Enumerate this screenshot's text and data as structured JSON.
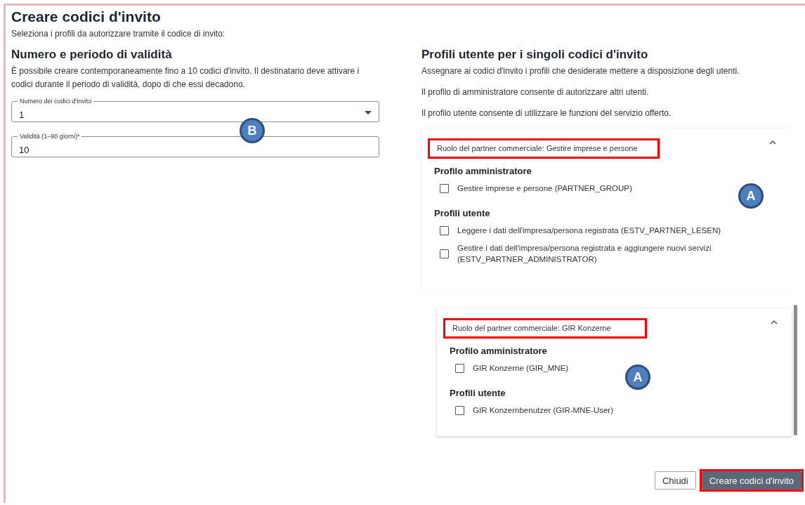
{
  "title": "Creare codici d'invito",
  "subtitle": "Seleziona i profili da autorizzare tramite il codice di invito:",
  "validity": {
    "heading": "Numero e periodo di validità",
    "description": "È possibile creare contemporaneamente fino a 10 codici d'invito. Il destinatario deve attivare i codici durante il periodo di validità, dopo di che essi decadono.",
    "callout": "B",
    "fields": [
      {
        "kind": "select",
        "label": "Numero dei codici d'invito",
        "value": "1"
      },
      {
        "kind": "text",
        "label": "Validità (1–90 giorni)*",
        "value": "10"
      }
    ]
  },
  "profiles": {
    "heading": "Profili utente per i singoli codici d'invito",
    "paragraphs": [
      "Assegnare ai codici d'invito i profili che desiderate mettere a disposizione degli utenti.",
      "Il profilo di amministratore consente di autorizzare altri utenti.",
      "Il profilo utente consente di utilizzare le funzioni del servizio offerto."
    ],
    "roles": [
      {
        "header": "Ruolo del partner commerciale: Gestire imprese e persone",
        "highlighted": true,
        "expanded": true,
        "callout": "A",
        "groups": [
          {
            "heading": "Profilo amministratore",
            "options": [
              {
                "label": "Gestire imprese e persone (PARTNER_GROUP)",
                "checked": false
              }
            ]
          },
          {
            "heading": "Profili utente",
            "options": [
              {
                "label": "Leggere i dati dell'impresa/persona registrata (ESTV_PARTNER_LESEN)",
                "checked": false
              },
              {
                "label": "Gestire i dati dell'impresa/persona registrata e aggiungere nuovi servizi (ESTV_PARTNER_ADMINISTRATOR)",
                "checked": false
              }
            ]
          }
        ]
      },
      {
        "header": "Ruolo del partner commerciale: GIR Konzerne",
        "highlighted": true,
        "expanded": true,
        "callout": "A",
        "groups": [
          {
            "heading": "Profilo amministratore",
            "options": [
              {
                "label": "GIR Konzerne (GIR_MNE)",
                "checked": false
              }
            ]
          },
          {
            "heading": "Profili utente",
            "options": [
              {
                "label": "GIR Konzernbenutzer (GIR-MNE-User)",
                "checked": false
              }
            ]
          }
        ]
      }
    ]
  },
  "buttons": [
    {
      "label": "Chiudi",
      "kind": "secondary",
      "highlighted": false
    },
    {
      "label": "Creare codici d'invito",
      "kind": "primary",
      "highlighted": true
    }
  ]
}
